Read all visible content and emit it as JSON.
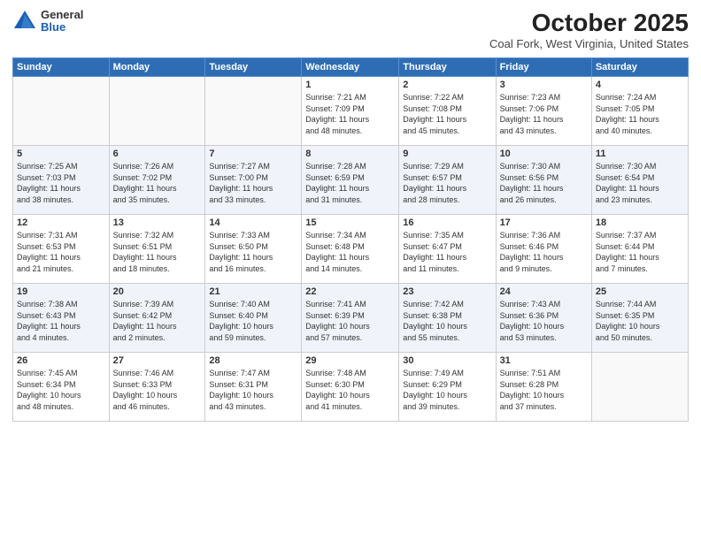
{
  "logo": {
    "general": "General",
    "blue": "Blue"
  },
  "header": {
    "month": "October 2025",
    "location": "Coal Fork, West Virginia, United States"
  },
  "weekdays": [
    "Sunday",
    "Monday",
    "Tuesday",
    "Wednesday",
    "Thursday",
    "Friday",
    "Saturday"
  ],
  "weeks": [
    [
      {
        "day": "",
        "info": ""
      },
      {
        "day": "",
        "info": ""
      },
      {
        "day": "",
        "info": ""
      },
      {
        "day": "1",
        "info": "Sunrise: 7:21 AM\nSunset: 7:09 PM\nDaylight: 11 hours\nand 48 minutes."
      },
      {
        "day": "2",
        "info": "Sunrise: 7:22 AM\nSunset: 7:08 PM\nDaylight: 11 hours\nand 45 minutes."
      },
      {
        "day": "3",
        "info": "Sunrise: 7:23 AM\nSunset: 7:06 PM\nDaylight: 11 hours\nand 43 minutes."
      },
      {
        "day": "4",
        "info": "Sunrise: 7:24 AM\nSunset: 7:05 PM\nDaylight: 11 hours\nand 40 minutes."
      }
    ],
    [
      {
        "day": "5",
        "info": "Sunrise: 7:25 AM\nSunset: 7:03 PM\nDaylight: 11 hours\nand 38 minutes."
      },
      {
        "day": "6",
        "info": "Sunrise: 7:26 AM\nSunset: 7:02 PM\nDaylight: 11 hours\nand 35 minutes."
      },
      {
        "day": "7",
        "info": "Sunrise: 7:27 AM\nSunset: 7:00 PM\nDaylight: 11 hours\nand 33 minutes."
      },
      {
        "day": "8",
        "info": "Sunrise: 7:28 AM\nSunset: 6:59 PM\nDaylight: 11 hours\nand 31 minutes."
      },
      {
        "day": "9",
        "info": "Sunrise: 7:29 AM\nSunset: 6:57 PM\nDaylight: 11 hours\nand 28 minutes."
      },
      {
        "day": "10",
        "info": "Sunrise: 7:30 AM\nSunset: 6:56 PM\nDaylight: 11 hours\nand 26 minutes."
      },
      {
        "day": "11",
        "info": "Sunrise: 7:30 AM\nSunset: 6:54 PM\nDaylight: 11 hours\nand 23 minutes."
      }
    ],
    [
      {
        "day": "12",
        "info": "Sunrise: 7:31 AM\nSunset: 6:53 PM\nDaylight: 11 hours\nand 21 minutes."
      },
      {
        "day": "13",
        "info": "Sunrise: 7:32 AM\nSunset: 6:51 PM\nDaylight: 11 hours\nand 18 minutes."
      },
      {
        "day": "14",
        "info": "Sunrise: 7:33 AM\nSunset: 6:50 PM\nDaylight: 11 hours\nand 16 minutes."
      },
      {
        "day": "15",
        "info": "Sunrise: 7:34 AM\nSunset: 6:48 PM\nDaylight: 11 hours\nand 14 minutes."
      },
      {
        "day": "16",
        "info": "Sunrise: 7:35 AM\nSunset: 6:47 PM\nDaylight: 11 hours\nand 11 minutes."
      },
      {
        "day": "17",
        "info": "Sunrise: 7:36 AM\nSunset: 6:46 PM\nDaylight: 11 hours\nand 9 minutes."
      },
      {
        "day": "18",
        "info": "Sunrise: 7:37 AM\nSunset: 6:44 PM\nDaylight: 11 hours\nand 7 minutes."
      }
    ],
    [
      {
        "day": "19",
        "info": "Sunrise: 7:38 AM\nSunset: 6:43 PM\nDaylight: 11 hours\nand 4 minutes."
      },
      {
        "day": "20",
        "info": "Sunrise: 7:39 AM\nSunset: 6:42 PM\nDaylight: 11 hours\nand 2 minutes."
      },
      {
        "day": "21",
        "info": "Sunrise: 7:40 AM\nSunset: 6:40 PM\nDaylight: 10 hours\nand 59 minutes."
      },
      {
        "day": "22",
        "info": "Sunrise: 7:41 AM\nSunset: 6:39 PM\nDaylight: 10 hours\nand 57 minutes."
      },
      {
        "day": "23",
        "info": "Sunrise: 7:42 AM\nSunset: 6:38 PM\nDaylight: 10 hours\nand 55 minutes."
      },
      {
        "day": "24",
        "info": "Sunrise: 7:43 AM\nSunset: 6:36 PM\nDaylight: 10 hours\nand 53 minutes."
      },
      {
        "day": "25",
        "info": "Sunrise: 7:44 AM\nSunset: 6:35 PM\nDaylight: 10 hours\nand 50 minutes."
      }
    ],
    [
      {
        "day": "26",
        "info": "Sunrise: 7:45 AM\nSunset: 6:34 PM\nDaylight: 10 hours\nand 48 minutes."
      },
      {
        "day": "27",
        "info": "Sunrise: 7:46 AM\nSunset: 6:33 PM\nDaylight: 10 hours\nand 46 minutes."
      },
      {
        "day": "28",
        "info": "Sunrise: 7:47 AM\nSunset: 6:31 PM\nDaylight: 10 hours\nand 43 minutes."
      },
      {
        "day": "29",
        "info": "Sunrise: 7:48 AM\nSunset: 6:30 PM\nDaylight: 10 hours\nand 41 minutes."
      },
      {
        "day": "30",
        "info": "Sunrise: 7:49 AM\nSunset: 6:29 PM\nDaylight: 10 hours\nand 39 minutes."
      },
      {
        "day": "31",
        "info": "Sunrise: 7:51 AM\nSunset: 6:28 PM\nDaylight: 10 hours\nand 37 minutes."
      },
      {
        "day": "",
        "info": ""
      }
    ]
  ]
}
